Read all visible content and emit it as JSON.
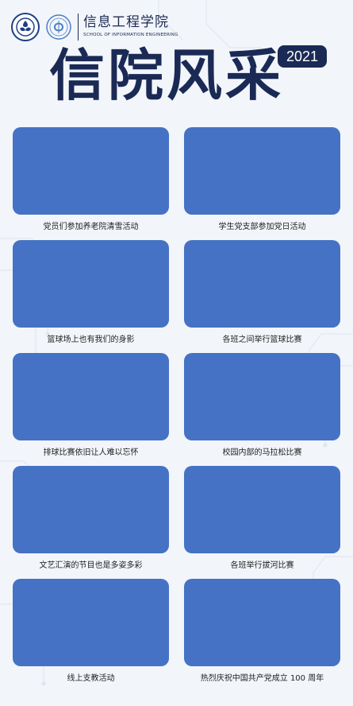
{
  "header": {
    "school_cn": "信息工程学院",
    "school_en": "SCHOOL OF INFORMATION ENGINEERING"
  },
  "title": "信院风采",
  "year": "2021",
  "colors": {
    "navy": "#1a2a55",
    "photo_placeholder": "#4572c4",
    "background": "#f2f5fa"
  },
  "cards": [
    {
      "caption": "党员们参加养老院清雪活动"
    },
    {
      "caption": "学生党支部参加党日活动"
    },
    {
      "caption": "篮球场上也有我们的身影"
    },
    {
      "caption": "各班之间举行篮球比赛"
    },
    {
      "caption": "排球比赛依旧让人难以忘怀"
    },
    {
      "caption": "校园内部的马拉松比赛"
    },
    {
      "caption": "文艺汇演的节目也是多姿多彩"
    },
    {
      "caption": "各班举行拔河比赛"
    },
    {
      "caption": "线上支教活动"
    },
    {
      "caption": "热烈庆祝中国共产党成立 100 周年"
    }
  ]
}
